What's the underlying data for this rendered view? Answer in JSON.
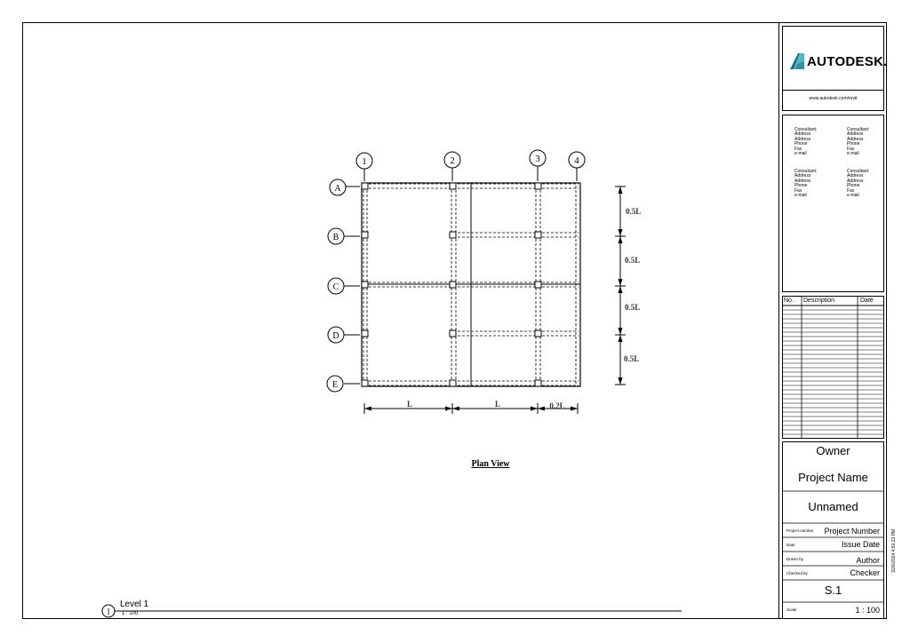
{
  "drawing": {
    "column_grids": [
      "1",
      "2",
      "3",
      "4"
    ],
    "row_grids": [
      "A",
      "B",
      "C",
      "D",
      "E"
    ],
    "vertical_dims": [
      "0.5L",
      "0.5L",
      "0.5L",
      "0.5L"
    ],
    "horizontal_dims": [
      "L",
      "L",
      "0.2L"
    ],
    "title": "Plan View"
  },
  "view": {
    "number": "1",
    "name": "Level 1",
    "scale": "1 : 100"
  },
  "title_block": {
    "logo_text": "AUTODESK.",
    "url": "www.autodesk.com/revit",
    "consultant_lines": [
      "Consultant:",
      "Address",
      "Address",
      "Phone",
      "Fax",
      "e-mail"
    ],
    "revision_headers": [
      "No.",
      "Description",
      "Date"
    ],
    "owner": "Owner",
    "project_name": "Project Name",
    "sheet_name": "Unnamed",
    "project_number_label": "Project number",
    "project_number": "Project Number",
    "date_label": "Date",
    "issue_date": "Issue Date",
    "drawn_by_label": "Drawn by",
    "author": "Author",
    "checked_by_label": "Checked by",
    "checker": "Checker",
    "sheet_number": "S.1",
    "scale_label": "Scale",
    "scale": "1 : 100",
    "timestamp": "3/26/2024 4:50:23 PM"
  },
  "colors": {
    "logo_dark": "#1b6f7a",
    "logo_light": "#4fb6c4",
    "logo_mid": "#2b93a3"
  }
}
